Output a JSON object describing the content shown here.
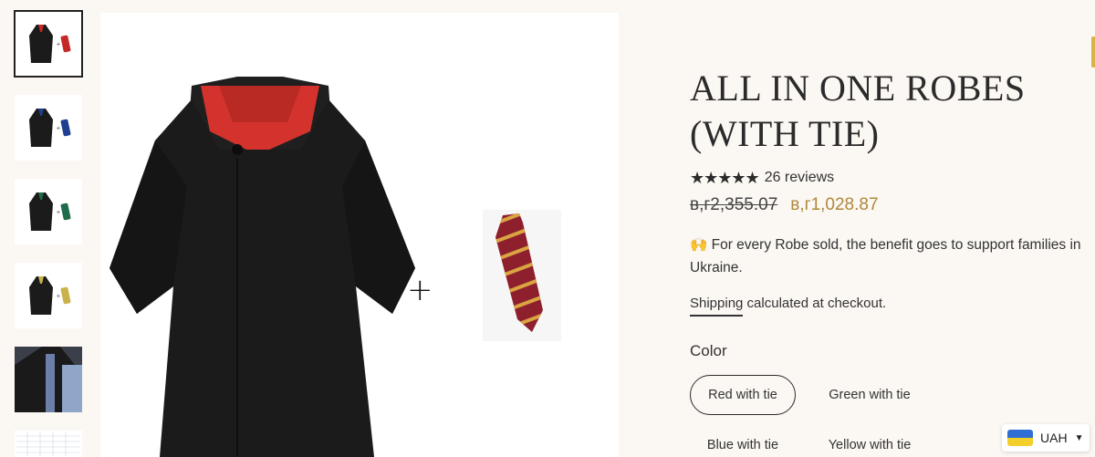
{
  "product": {
    "title": "ALL IN ONE ROBES (WITH TIE)",
    "stars": "★★★★★",
    "reviews": "26 reviews",
    "old_price": "в,г2,355.07",
    "new_price": "в,г1,028.87",
    "note": "🙌 For every Robe sold, the benefit goes to support families in Ukraine.",
    "shipping_link": "Shipping",
    "shipping_rest": " calculated at checkout.",
    "color_label": "Color",
    "colors": [
      {
        "label": "Red with tie",
        "selected": true
      },
      {
        "label": "Green with tie",
        "selected": false
      },
      {
        "label": "Blue with tie",
        "selected": false
      },
      {
        "label": "Yellow with tie",
        "selected": false
      }
    ]
  },
  "gallery": {
    "plus": "+",
    "thumbs": [
      {
        "kind": "robe-tie",
        "accent": "#c62828"
      },
      {
        "kind": "robe-tie",
        "accent": "#1f3f8f"
      },
      {
        "kind": "robe-tie",
        "accent": "#1f6b4a"
      },
      {
        "kind": "robe-tie",
        "accent": "#c9b24a"
      },
      {
        "kind": "photo"
      },
      {
        "kind": "chart"
      }
    ]
  },
  "currency": {
    "code": "UAH",
    "flag": "ukraine-flag",
    "chevron": "chevron-down-icon"
  },
  "colors": {
    "background": "#fbf7f3",
    "price_accent": "#b0883a",
    "robe": "#1b1b1b",
    "robe_lining": "#d3332c",
    "tie_base": "#8e1f2d",
    "tie_stripe": "#d9a441"
  }
}
